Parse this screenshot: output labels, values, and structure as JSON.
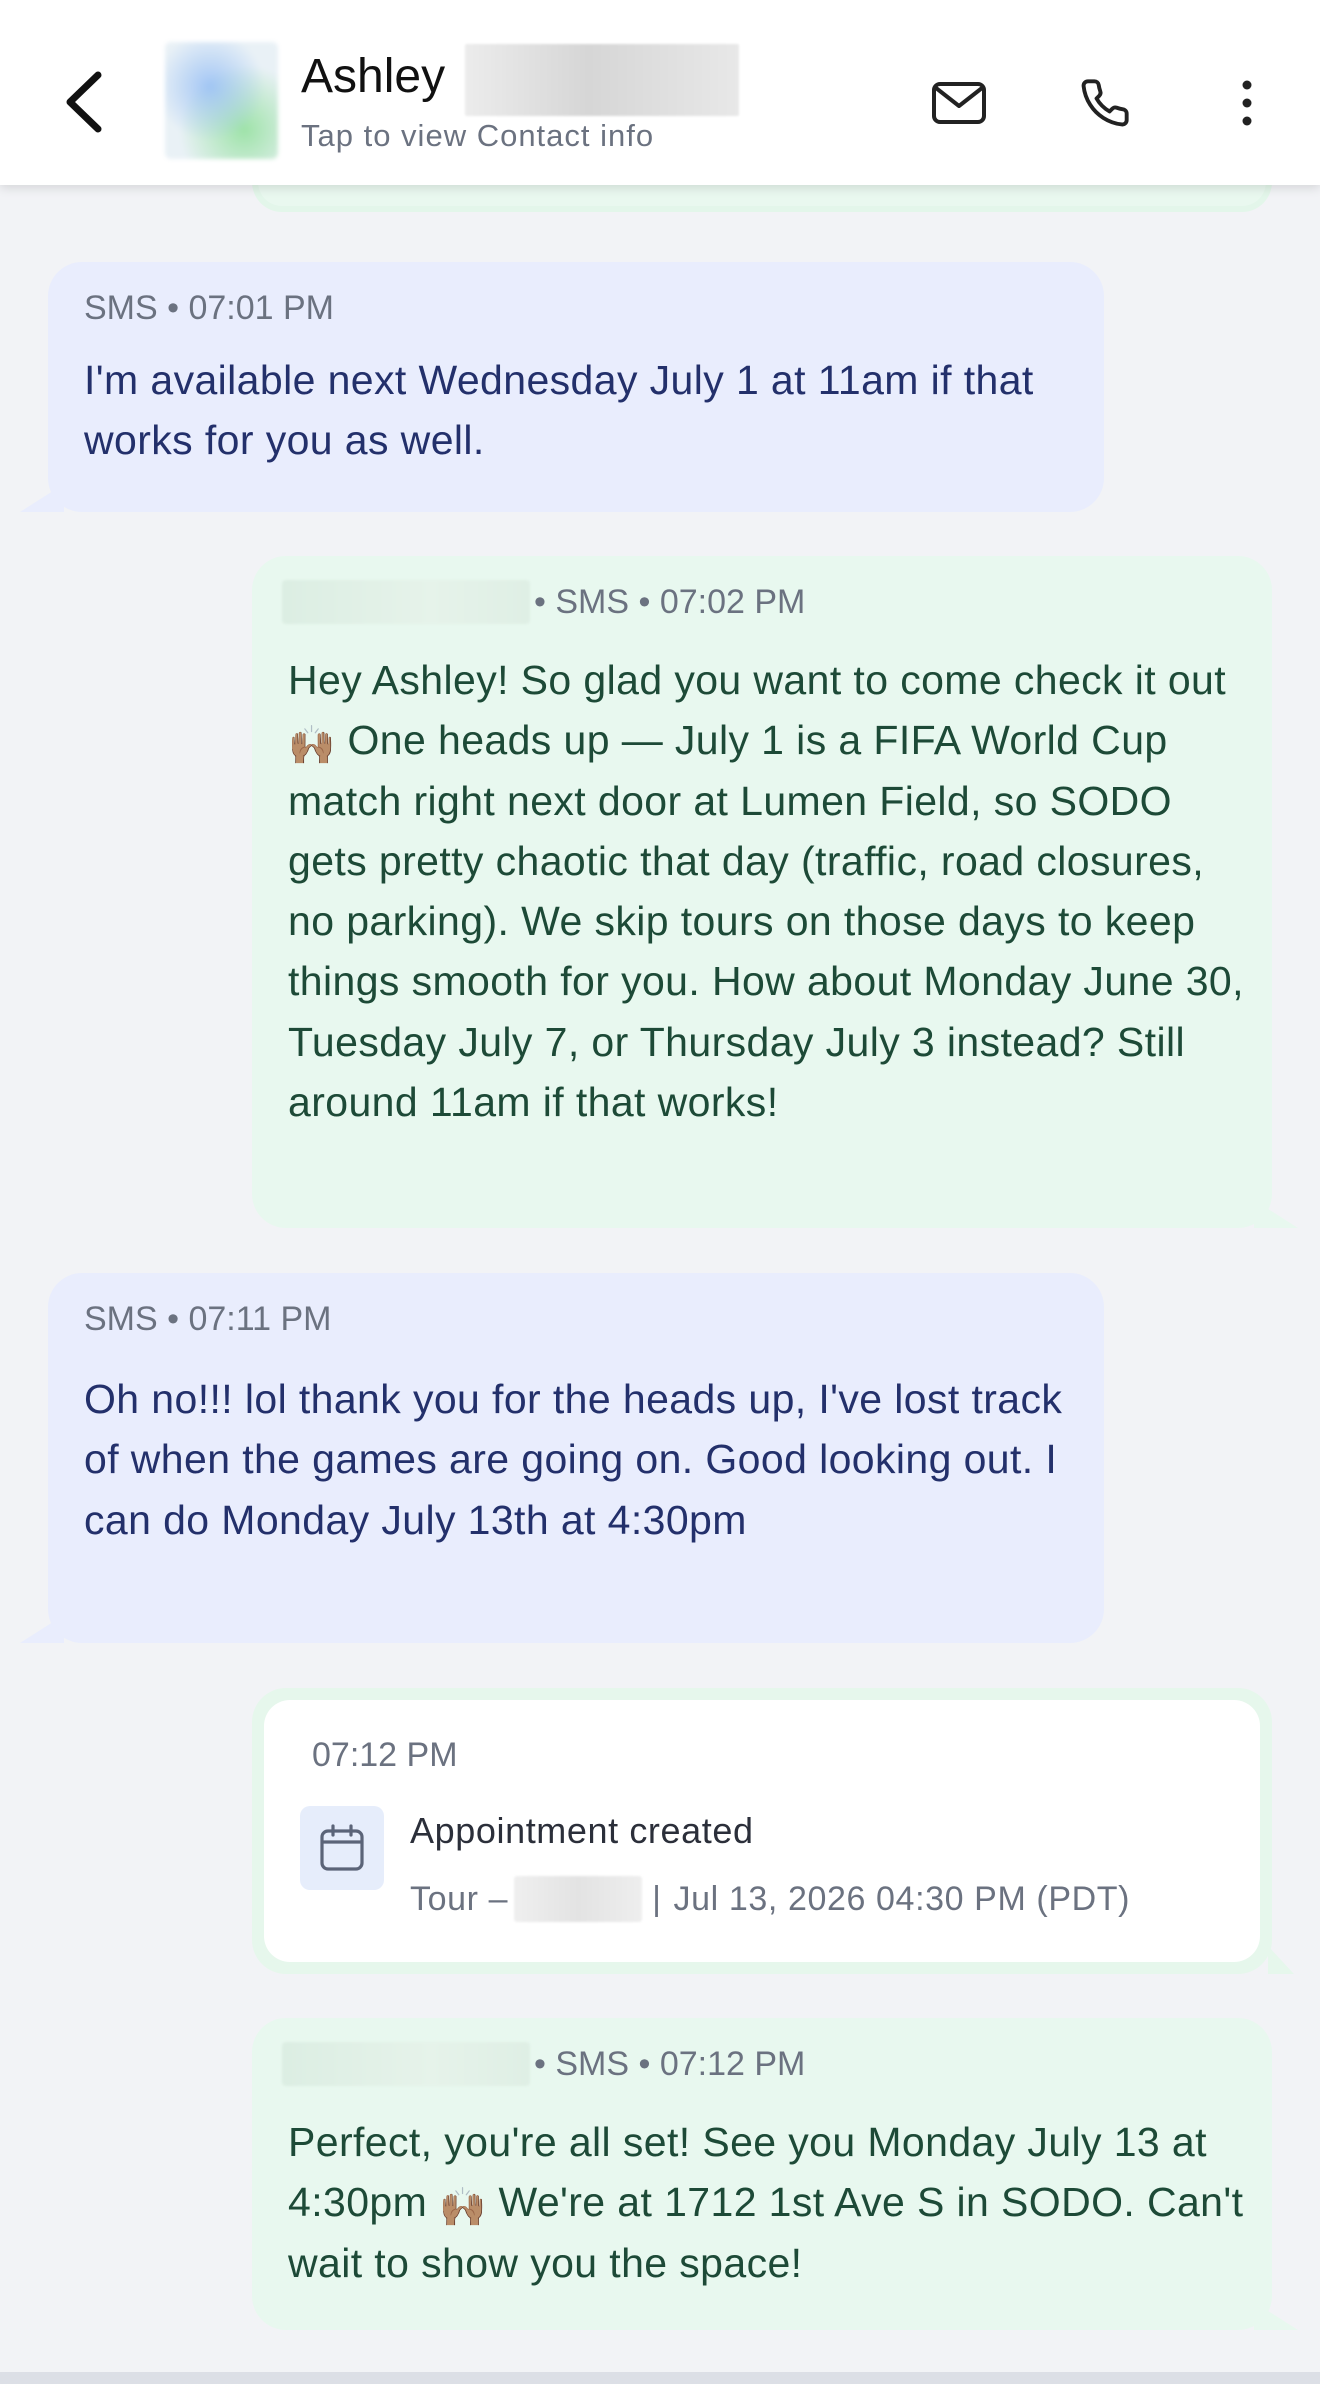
{
  "header": {
    "contact_name": "Ashley",
    "subtitle": "Tap to view Contact info",
    "icons": {
      "back": "chevron-left-icon",
      "mail": "mail-icon",
      "phone": "phone-icon",
      "more": "more-vertical-icon"
    }
  },
  "messages": [
    {
      "direction": "incoming",
      "meta": "SMS • 07:01 PM",
      "text": "I'm available next Wednesday July 1 at 11am if that works for you as well."
    },
    {
      "direction": "outgoing",
      "meta": "• SMS • 07:02 PM",
      "text_part1": "Hey Ashley! So glad you want to come check it out ",
      "emoji": "🙌🏽",
      "text_part2": "  One heads up — July 1 is a FIFA World Cup match right next door at Lumen Field, so SODO gets pretty chaotic that day (traffic, road closures, no parking). We skip tours on those days to keep things smooth for you. How about Monday June 30, Tuesday July 7, or Thursday July 3 instead? Still around 11am if that works!"
    },
    {
      "direction": "incoming",
      "meta": "SMS • 07:11 PM",
      "text": "Oh no!!! lol thank you for the heads up, I've lost track of when the games are going on. Good looking out. I can do Monday July 13th at 4:30pm"
    },
    {
      "direction": "outgoing",
      "meta": "• SMS • 07:12 PM",
      "text_part1": "Perfect, you're all set! See you Monday July 13 at 4:30pm ",
      "emoji": "🙌🏽",
      "text_part2": "  We're at 1712 1st Ave S in SODO. Can't wait to show you the space!"
    }
  ],
  "appointment": {
    "time": "07:12 PM",
    "title": "Appointment created",
    "tour_label": "Tour –",
    "separator": "|",
    "datetime": "Jul 13, 2026 04:30 PM (PDT)",
    "icon": "calendar-icon"
  },
  "colors": {
    "incoming_bg": "#e9edfd",
    "incoming_text": "#23306b",
    "outgoing_bg": "#e8f8ef",
    "outgoing_text": "#1d4a37",
    "meta_text": "#6b7280",
    "page_bg": "#f2f3f6"
  }
}
